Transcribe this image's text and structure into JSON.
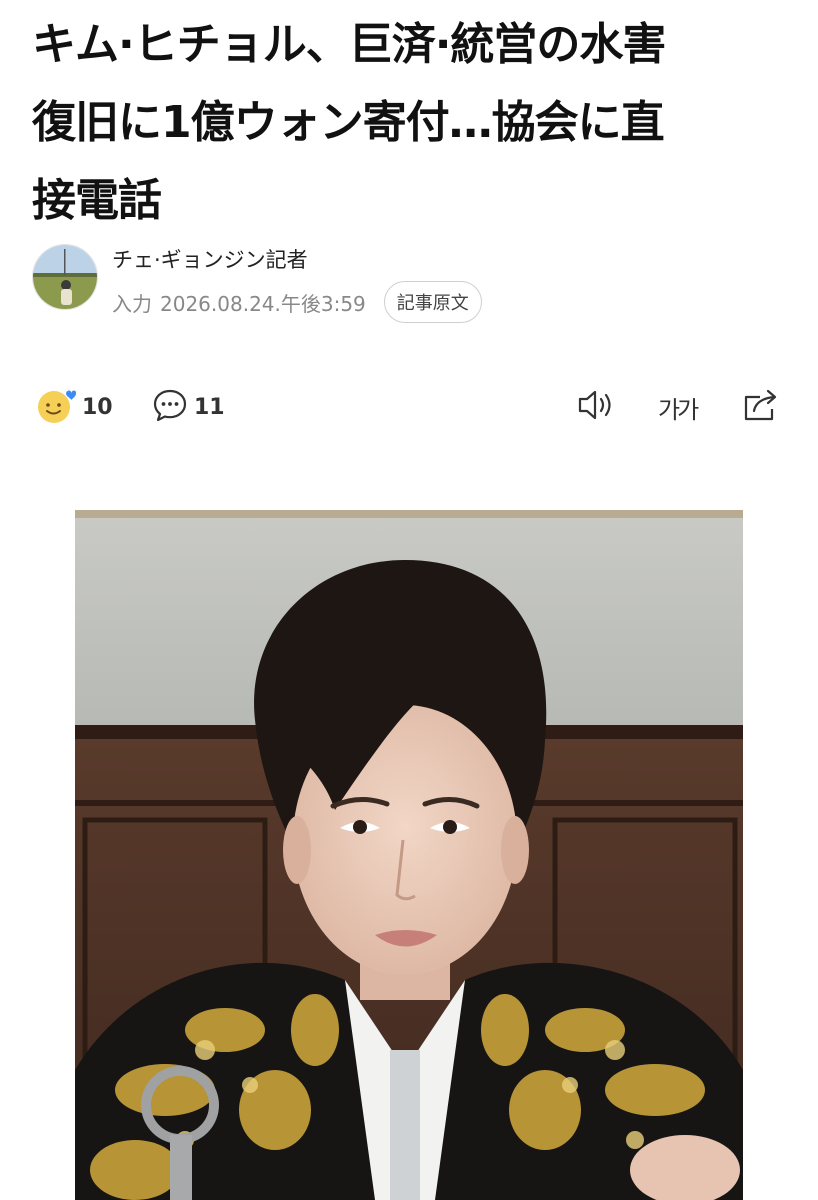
{
  "article": {
    "headline_lines": [
      "キム·ヒチョル、巨済·統営の水害",
      "復旧に1億ウォン寄付…協会に直",
      "接電話"
    ]
  },
  "byline": {
    "reporter": "チェ·ギョンジン記者",
    "input_label": "入力",
    "date": "2026.08.24.午後3:59",
    "original_button": "記事原文"
  },
  "actions": {
    "reaction_count": "10",
    "comment_count": "11",
    "font_size_label": "가가"
  },
  "icons": {
    "reaction": "smiley-heart-icon",
    "comment": "speech-bubble-icon",
    "listen": "speaker-icon",
    "font": "font-size-icon",
    "share": "share-icon"
  },
  "colors": {
    "reaction_face": "#f6cf56",
    "reaction_heart": "#3d8bf2",
    "jacket_gold": "#c9a23a"
  }
}
